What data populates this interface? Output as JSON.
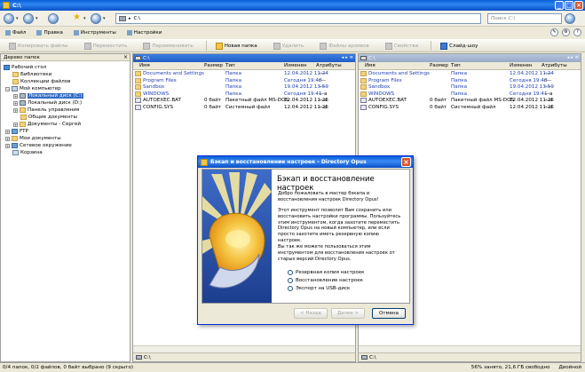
{
  "window": {
    "title": "C:\\"
  },
  "nav": {
    "address": "C:\\",
    "search_placeholder": "Поиск C:\\"
  },
  "menu": [
    "Файл",
    "Правка",
    "Инструменты",
    "Настройки"
  ],
  "toolbar": [
    {
      "label": "Копировать файлы",
      "enabled": false
    },
    {
      "label": "Переместить",
      "enabled": false
    },
    {
      "label": "Переименовать",
      "enabled": false
    },
    {
      "label": "Новая папка",
      "enabled": true
    },
    {
      "label": "Удалить",
      "enabled": false
    },
    {
      "label": "Файлы архивов",
      "enabled": false
    },
    {
      "label": "Свойства",
      "enabled": false
    },
    {
      "label": "Слайд-шоу",
      "enabled": true
    }
  ],
  "tree": {
    "title": "Дерево папок",
    "items": [
      {
        "label": "Рабочий стол",
        "icon": "desktop-icon"
      },
      {
        "label": "Библиотеки",
        "icon": "folder-icon"
      },
      {
        "label": "Коллекции файлов",
        "icon": "folder-icon"
      },
      {
        "label": "Мой компьютер",
        "icon": "computer-icon"
      },
      {
        "label": "Локальный диск (C:)",
        "icon": "drive-icon",
        "selected": true
      },
      {
        "label": "Локальный диск (D:)",
        "icon": "drive-icon"
      },
      {
        "label": "Панель управления",
        "icon": "folder-icon"
      },
      {
        "label": "Общие документы",
        "icon": "folder-icon"
      },
      {
        "label": "Документы - Сергей",
        "icon": "folder-icon"
      },
      {
        "label": "FTP",
        "icon": "network-icon"
      },
      {
        "label": "Мои документы",
        "icon": "folder-icon"
      },
      {
        "label": "Сетевое окружение",
        "icon": "network-icon"
      },
      {
        "label": "Корзина",
        "icon": "trash-icon"
      }
    ]
  },
  "listers": {
    "columns": [
      "Имя",
      "Размер",
      "Тип",
      "Изменен",
      "Атрибуты"
    ],
    "left": {
      "path": "C:\\",
      "files": [
        {
          "name": "Documents and Settings",
          "size": "",
          "type": "Папка",
          "modified": "12.04.2012  11:24",
          "attr": "----",
          "icon": "folder"
        },
        {
          "name": "Program Files",
          "size": "",
          "type": "Папка",
          "modified": "Сегодня  19:40",
          "attr": "r---",
          "icon": "folder"
        },
        {
          "name": "Sandbox",
          "size": "",
          "type": "Папка",
          "modified": "19.04.2012  13:59",
          "attr": "----",
          "icon": "folder"
        },
        {
          "name": "WINDOWS",
          "size": "",
          "type": "Папка",
          "modified": "Сегодня  19:41",
          "attr": "---a",
          "icon": "folder"
        },
        {
          "name": "AUTOEXEC.BAT",
          "size": "0 байт",
          "type": "Пакетный файл MS-DOS",
          "modified": "12.04.2012  11:25",
          "attr": "---a",
          "icon": "file"
        },
        {
          "name": "CONFIG.SYS",
          "size": "0 байт",
          "type": "Системный файл",
          "modified": "12.04.2012  11:25",
          "attr": "---a",
          "icon": "file"
        }
      ],
      "footer": "C:\\"
    },
    "right": {
      "path": "C:\\",
      "files": [
        {
          "name": "Documents and Settings",
          "size": "",
          "type": "Папка",
          "modified": "12.04.2012  11:24",
          "attr": "----",
          "icon": "folder"
        },
        {
          "name": "Program Files",
          "size": "",
          "type": "Папка",
          "modified": "Сегодня  19:40",
          "attr": "r---",
          "icon": "folder"
        },
        {
          "name": "Sandbox",
          "size": "",
          "type": "Папка",
          "modified": "19.04.2012  13:59",
          "attr": "----",
          "icon": "folder"
        },
        {
          "name": "WINDOWS",
          "size": "",
          "type": "Папка",
          "modified": "Сегодня  19:41",
          "attr": "---a",
          "icon": "folder"
        },
        {
          "name": "AUTOEXEC.BAT",
          "size": "0 байт",
          "type": "Пакетный файл MS-DOS",
          "modified": "12.04.2012  11:25",
          "attr": "---a",
          "icon": "file"
        },
        {
          "name": "CONFIG.SYS",
          "size": "0 байт",
          "type": "Системный файл",
          "modified": "12.04.2012  11:25",
          "attr": "---a",
          "icon": "file"
        }
      ],
      "footer": "C:\\"
    }
  },
  "status": {
    "left": "0/4 папок, 0/2 файлов, 0 байт выбрано (9 скрыто)",
    "disk": "56% занято, 21,6 ГБ свободно",
    "mode": "Двойной"
  },
  "dialog": {
    "title": "Бэкап и восстановление настроек - Directory Opus",
    "heading": "Бэкап и восстановление настроек",
    "paragraphs": [
      "Добро пожаловать в мастер бэкапа и восстановления настроек Directory Opus!",
      "Этот инструмент позволит Вам сохранить или восстановить настройки программы. Пользуйтесь этим инструментом, когда захотите переместить Directory Opus на новый компьютер, или если просто захотите иметь резервную копию настроек.",
      "Вы так же можете пользоваться этим инструментом для восстановления настроек от старых версий Directory Opus."
    ],
    "options": [
      "Резервная копия настроек",
      "Восстановление настроек",
      "Экспорт на USB-диск"
    ],
    "back": "< Назад",
    "next": "Далее >",
    "cancel": "Отмена"
  },
  "colors": {
    "accent": "#316ac5",
    "titlebar": "#0a5fd7"
  }
}
